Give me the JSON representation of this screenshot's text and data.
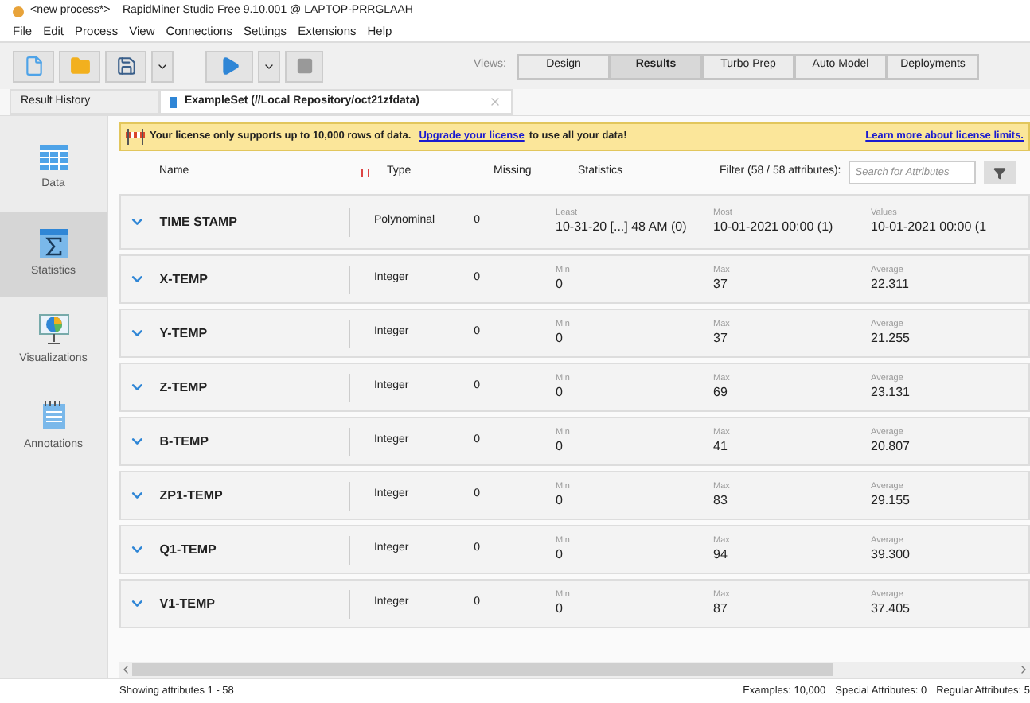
{
  "window": {
    "title": "<new process*> – RapidMiner Studio Free 9.10.001 @ LAPTOP-PRRGLAAH"
  },
  "menu": [
    "File",
    "Edit",
    "Process",
    "View",
    "Connections",
    "Settings",
    "Extensions",
    "Help"
  ],
  "views": {
    "label": "Views:",
    "items": [
      {
        "label": "Design",
        "selected": false
      },
      {
        "label": "Results",
        "selected": true
      },
      {
        "label": "Turbo Prep",
        "selected": false
      },
      {
        "label": "Auto Model",
        "selected": false
      },
      {
        "label": "Deployments",
        "selected": false
      }
    ]
  },
  "tabs": [
    {
      "label": "Result History",
      "selected": false,
      "kind": "plain"
    },
    {
      "label": "ExampleSet (//Local Repository/oct21zfdata)",
      "selected": true,
      "kind": "data"
    }
  ],
  "sidebar": [
    {
      "label": "Data",
      "selected": false,
      "kind": "table"
    },
    {
      "label": "Statistics",
      "selected": true,
      "kind": "stats"
    },
    {
      "label": "Visualizations",
      "selected": false,
      "kind": "chart"
    },
    {
      "label": "Annotations",
      "selected": false,
      "kind": "notes"
    }
  ],
  "banner": {
    "before": "Your license only supports up to 10,000 rows of data.",
    "link": "Upgrade your license",
    "after": "to use all your data!",
    "more": "Learn more about license limits."
  },
  "header": {
    "name": "Name",
    "type": "Type",
    "missing": "Missing",
    "statistics": "Statistics",
    "filter": "Filter (58 / 58 attributes):",
    "placeholder": "Search for Attributes"
  },
  "rows": [
    {
      "name": "TIME STAMP",
      "type": "Polynominal",
      "missing": "0",
      "stats": [
        [
          "Least",
          "10-31-20 [...] 48 AM (0)"
        ],
        [
          "Most",
          "10-01-2021 00:00 (1)"
        ],
        [
          "Values",
          "10-01-2021 00:00 (1"
        ]
      ]
    },
    {
      "name": "X-TEMP",
      "type": "Integer",
      "missing": "0",
      "stats": [
        [
          "Min",
          "0"
        ],
        [
          "Max",
          "37"
        ],
        [
          "Average",
          "22.311"
        ]
      ]
    },
    {
      "name": "Y-TEMP",
      "type": "Integer",
      "missing": "0",
      "stats": [
        [
          "Min",
          "0"
        ],
        [
          "Max",
          "37"
        ],
        [
          "Average",
          "21.255"
        ]
      ]
    },
    {
      "name": "Z-TEMP",
      "type": "Integer",
      "missing": "0",
      "stats": [
        [
          "Min",
          "0"
        ],
        [
          "Max",
          "69"
        ],
        [
          "Average",
          "23.131"
        ]
      ]
    },
    {
      "name": "B-TEMP",
      "type": "Integer",
      "missing": "0",
      "stats": [
        [
          "Min",
          "0"
        ],
        [
          "Max",
          "41"
        ],
        [
          "Average",
          "20.807"
        ]
      ]
    },
    {
      "name": "ZP1-TEMP",
      "type": "Integer",
      "missing": "0",
      "stats": [
        [
          "Min",
          "0"
        ],
        [
          "Max",
          "83"
        ],
        [
          "Average",
          "29.155"
        ]
      ]
    },
    {
      "name": "Q1-TEMP",
      "type": "Integer",
      "missing": "0",
      "stats": [
        [
          "Min",
          "0"
        ],
        [
          "Max",
          "94"
        ],
        [
          "Average",
          "39.300"
        ]
      ]
    },
    {
      "name": "V1-TEMP",
      "type": "Integer",
      "missing": "0",
      "stats": [
        [
          "Min",
          "0"
        ],
        [
          "Max",
          "87"
        ],
        [
          "Average",
          "37.405"
        ]
      ]
    }
  ],
  "status": {
    "showing": "Showing attributes 1 - 58",
    "examples": "Examples: 10,000",
    "special": "Special Attributes: 0",
    "regular": "Regular Attributes: 5"
  }
}
